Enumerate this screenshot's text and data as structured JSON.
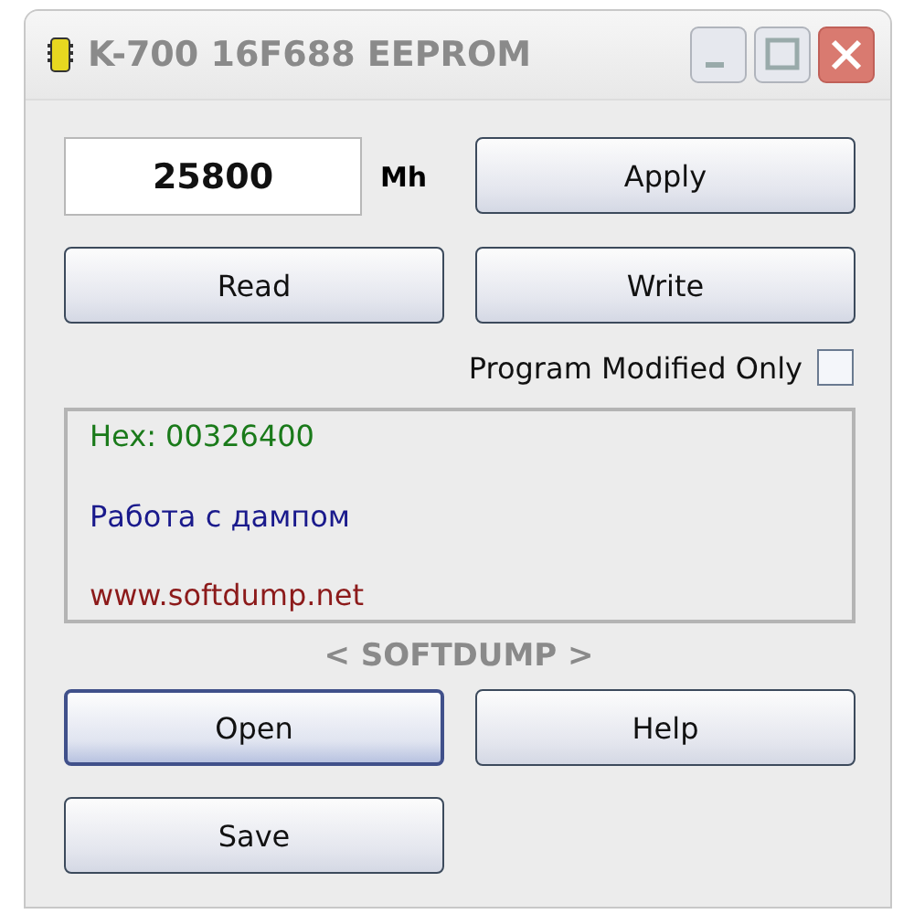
{
  "window": {
    "title": "K-700 16F688 EEPROM"
  },
  "value_field": {
    "value": "25800",
    "unit": "Mh"
  },
  "buttons_top": [
    {
      "label": "Apply"
    },
    {
      "label": "Read"
    },
    {
      "label": "Write"
    }
  ],
  "option": {
    "label": "Program Modified Only",
    "checked": false
  },
  "log": [
    {
      "text": "Hex: 00326400",
      "color": "#1a7a1a"
    },
    {
      "text": "Работа с дампом",
      "color": "#1a1a8c"
    },
    {
      "text": "www.softdump.net",
      "color": "#8c1a1a"
    }
  ],
  "brand": "< SOFTDUMP >",
  "buttons_bottom": [
    {
      "label": "Open",
      "focused": true
    },
    {
      "label": "Help",
      "focused": false
    },
    {
      "label": "Save",
      "focused": false
    }
  ]
}
